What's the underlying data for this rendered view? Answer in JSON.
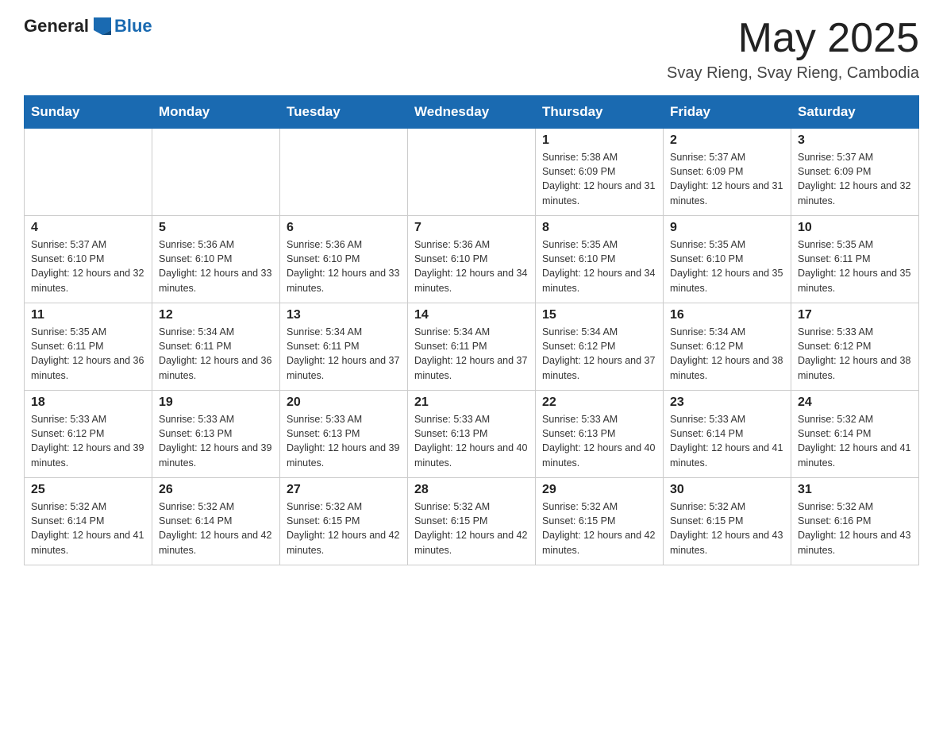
{
  "header": {
    "logo_general": "General",
    "logo_blue": "Blue",
    "month_title": "May 2025",
    "location": "Svay Rieng, Svay Rieng, Cambodia"
  },
  "days_of_week": [
    "Sunday",
    "Monday",
    "Tuesday",
    "Wednesday",
    "Thursday",
    "Friday",
    "Saturday"
  ],
  "weeks": [
    [
      {
        "day": "",
        "info": ""
      },
      {
        "day": "",
        "info": ""
      },
      {
        "day": "",
        "info": ""
      },
      {
        "day": "",
        "info": ""
      },
      {
        "day": "1",
        "info": "Sunrise: 5:38 AM\nSunset: 6:09 PM\nDaylight: 12 hours and 31 minutes."
      },
      {
        "day": "2",
        "info": "Sunrise: 5:37 AM\nSunset: 6:09 PM\nDaylight: 12 hours and 31 minutes."
      },
      {
        "day": "3",
        "info": "Sunrise: 5:37 AM\nSunset: 6:09 PM\nDaylight: 12 hours and 32 minutes."
      }
    ],
    [
      {
        "day": "4",
        "info": "Sunrise: 5:37 AM\nSunset: 6:10 PM\nDaylight: 12 hours and 32 minutes."
      },
      {
        "day": "5",
        "info": "Sunrise: 5:36 AM\nSunset: 6:10 PM\nDaylight: 12 hours and 33 minutes."
      },
      {
        "day": "6",
        "info": "Sunrise: 5:36 AM\nSunset: 6:10 PM\nDaylight: 12 hours and 33 minutes."
      },
      {
        "day": "7",
        "info": "Sunrise: 5:36 AM\nSunset: 6:10 PM\nDaylight: 12 hours and 34 minutes."
      },
      {
        "day": "8",
        "info": "Sunrise: 5:35 AM\nSunset: 6:10 PM\nDaylight: 12 hours and 34 minutes."
      },
      {
        "day": "9",
        "info": "Sunrise: 5:35 AM\nSunset: 6:10 PM\nDaylight: 12 hours and 35 minutes."
      },
      {
        "day": "10",
        "info": "Sunrise: 5:35 AM\nSunset: 6:11 PM\nDaylight: 12 hours and 35 minutes."
      }
    ],
    [
      {
        "day": "11",
        "info": "Sunrise: 5:35 AM\nSunset: 6:11 PM\nDaylight: 12 hours and 36 minutes."
      },
      {
        "day": "12",
        "info": "Sunrise: 5:34 AM\nSunset: 6:11 PM\nDaylight: 12 hours and 36 minutes."
      },
      {
        "day": "13",
        "info": "Sunrise: 5:34 AM\nSunset: 6:11 PM\nDaylight: 12 hours and 37 minutes."
      },
      {
        "day": "14",
        "info": "Sunrise: 5:34 AM\nSunset: 6:11 PM\nDaylight: 12 hours and 37 minutes."
      },
      {
        "day": "15",
        "info": "Sunrise: 5:34 AM\nSunset: 6:12 PM\nDaylight: 12 hours and 37 minutes."
      },
      {
        "day": "16",
        "info": "Sunrise: 5:34 AM\nSunset: 6:12 PM\nDaylight: 12 hours and 38 minutes."
      },
      {
        "day": "17",
        "info": "Sunrise: 5:33 AM\nSunset: 6:12 PM\nDaylight: 12 hours and 38 minutes."
      }
    ],
    [
      {
        "day": "18",
        "info": "Sunrise: 5:33 AM\nSunset: 6:12 PM\nDaylight: 12 hours and 39 minutes."
      },
      {
        "day": "19",
        "info": "Sunrise: 5:33 AM\nSunset: 6:13 PM\nDaylight: 12 hours and 39 minutes."
      },
      {
        "day": "20",
        "info": "Sunrise: 5:33 AM\nSunset: 6:13 PM\nDaylight: 12 hours and 39 minutes."
      },
      {
        "day": "21",
        "info": "Sunrise: 5:33 AM\nSunset: 6:13 PM\nDaylight: 12 hours and 40 minutes."
      },
      {
        "day": "22",
        "info": "Sunrise: 5:33 AM\nSunset: 6:13 PM\nDaylight: 12 hours and 40 minutes."
      },
      {
        "day": "23",
        "info": "Sunrise: 5:33 AM\nSunset: 6:14 PM\nDaylight: 12 hours and 41 minutes."
      },
      {
        "day": "24",
        "info": "Sunrise: 5:32 AM\nSunset: 6:14 PM\nDaylight: 12 hours and 41 minutes."
      }
    ],
    [
      {
        "day": "25",
        "info": "Sunrise: 5:32 AM\nSunset: 6:14 PM\nDaylight: 12 hours and 41 minutes."
      },
      {
        "day": "26",
        "info": "Sunrise: 5:32 AM\nSunset: 6:14 PM\nDaylight: 12 hours and 42 minutes."
      },
      {
        "day": "27",
        "info": "Sunrise: 5:32 AM\nSunset: 6:15 PM\nDaylight: 12 hours and 42 minutes."
      },
      {
        "day": "28",
        "info": "Sunrise: 5:32 AM\nSunset: 6:15 PM\nDaylight: 12 hours and 42 minutes."
      },
      {
        "day": "29",
        "info": "Sunrise: 5:32 AM\nSunset: 6:15 PM\nDaylight: 12 hours and 42 minutes."
      },
      {
        "day": "30",
        "info": "Sunrise: 5:32 AM\nSunset: 6:15 PM\nDaylight: 12 hours and 43 minutes."
      },
      {
        "day": "31",
        "info": "Sunrise: 5:32 AM\nSunset: 6:16 PM\nDaylight: 12 hours and 43 minutes."
      }
    ]
  ]
}
